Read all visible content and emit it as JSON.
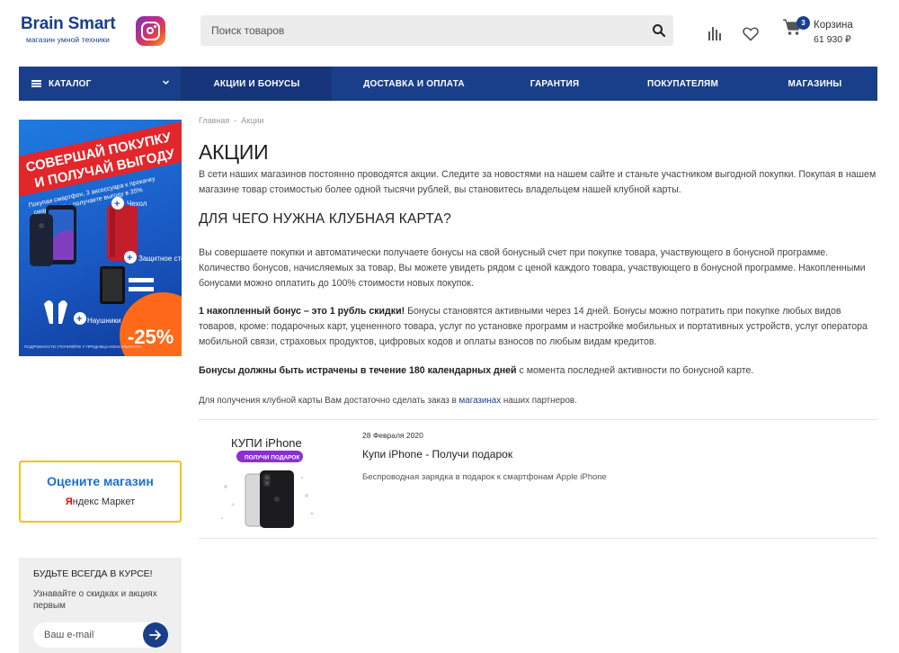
{
  "header": {
    "logo_title": "Brain Smart",
    "logo_sub": "магазин умной техники",
    "search_placeholder": "Поиск товаров",
    "cart_count": "3",
    "cart_label": "Корзина",
    "cart_sum": "61 930 ₽"
  },
  "nav": {
    "catalog": "КАТАЛОГ",
    "items": [
      {
        "label": "АКЦИИ И БОНУСЫ",
        "width": 167
      },
      {
        "label": "ДОСТАВКА И ОПЛАТА",
        "width": 183
      },
      {
        "label": "ГАРАНТИЯ",
        "width": 130
      },
      {
        "label": "ПОКУПАТЕЛЯМ",
        "width": 155
      },
      {
        "label": "МАГАЗИНЫ",
        "width": 139
      }
    ]
  },
  "banner": {
    "headline1": "СОВЕРШАЙ ПОКУПКУ",
    "headline2": "И ПОЛУЧАЙ ВЫГОДУ",
    "tagline1": "Покупая смартфон, 3 аксессуара к прокачку",
    "tagline2": "смартфона – получаете выгоду в 35%",
    "label_case": "Чехол",
    "label_glass": "Защитное стекло",
    "label_headphones": "Наушники",
    "discount": "-25%",
    "footer": "ПОДРОБНОСТИ УТОЧНЯЙТЕ У ПРОДАВЦА-КОНСУЛЬТАНТА"
  },
  "rate": {
    "title": "Оцените магазин",
    "brand_y": "Я",
    "brand_rest": "ндекс",
    "market": "Маркет"
  },
  "subscribe": {
    "title": "БУДЬТЕ ВСЕГДА В КУРСЕ!",
    "text": "Узнавайте о скидках и акциях первым",
    "placeholder": "Ваш e-mail"
  },
  "breadcrumb": {
    "home": "Главная",
    "sep": "-",
    "current": "Акции"
  },
  "content": {
    "title": "АКЦИИ",
    "intro": "В сети наших магазинов постоянно проводятся акции.  Следите за новостями на нашем сайте и станьте  участником выгодной покупки. Покупая в нашем магазине товар стоимостью более одной тысячи  рублей, вы становитесь владельцем нашей клубной карты.",
    "h2": "ДЛЯ ЧЕГО НУЖНА КЛУБНАЯ КАРТА?",
    "p1": "Вы совершаете покупки и автоматически получаете бонусы на свой бонусный счет при покупке  товара, участвующего в бонусной программе. Количество бонусов, начисляемых за товар, Вы можете увидеть рядом с ценой каждого товара, участвующего в бонусной  программе. Накопленными бонусами можно оплатить до 100% стоимости новых покупок.",
    "p2_bold": "1 накопленный бонус – это 1 рубль скидки!",
    "p2_rest": " Бонусы становятся активными через 14 дней. Бонусы можно потратить при покупке любых видов товаров, кроме: подарочных карт, уцененного товара, услуг по установке программ и настройке мобильных и портативных устройств, услуг оператора мобильной связи, страховых продуктов, цифровых кодов и оплаты взносов по любым видам кредитов.",
    "p3_bold": "Бонусы должны быть истрачены в течение 180 календарных дней",
    "p3_rest": " с момента последней активности по бонусной карте.",
    "p4_start": "Для получения клубной карты Вам достаточно сделать заказ в ",
    "p4_link": "магазинах",
    "p4_end": " наших партнеров."
  },
  "promo": {
    "img_title": "КУПИ iPhone",
    "img_badge": "ПОЛУЧИ ПОДАРОК",
    "date": "28 Февраля 2020",
    "title": "Купи iPhone - Получи подарок",
    "desc": "Беспроводная зарядка в подарок к смартфонам Apple iPhone"
  },
  "colors": {
    "brand": "#1a3f8a",
    "accent_yellow": "#f5c21a",
    "link": "#1a6fd0"
  }
}
